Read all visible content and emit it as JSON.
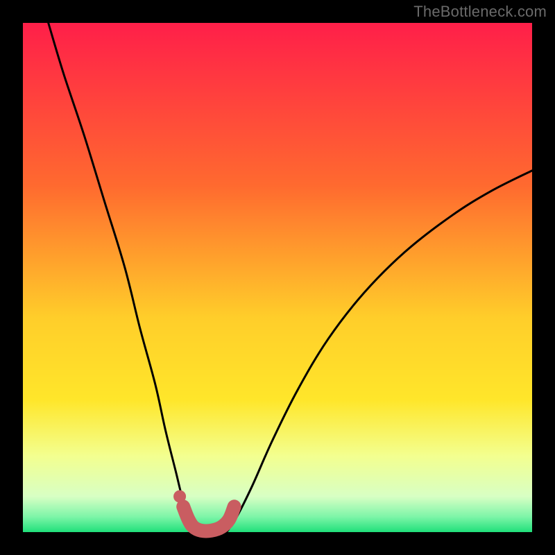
{
  "watermark": "TheBottleneck.com",
  "chart_data": {
    "type": "line",
    "title": "",
    "xlabel": "",
    "ylabel": "",
    "xlim": [
      0,
      100
    ],
    "ylim": [
      0,
      100
    ],
    "grid": false,
    "legend": false,
    "series": [
      {
        "name": "left-branch",
        "x": [
          5,
          8,
          12,
          16,
          20,
          23,
          26,
          28,
          30,
          31.5,
          33,
          34
        ],
        "y": [
          100,
          90,
          78,
          65,
          52,
          40,
          29,
          20,
          12,
          6,
          2,
          0
        ]
      },
      {
        "name": "right-branch",
        "x": [
          40,
          42,
          45,
          49,
          54,
          60,
          67,
          75,
          84,
          92,
          100
        ],
        "y": [
          0,
          3,
          9,
          18,
          28,
          38,
          47,
          55,
          62,
          67,
          71
        ]
      }
    ],
    "highlight_segment": {
      "name": "bottom-u",
      "x": [
        31.5,
        32.5,
        33.5,
        35,
        37,
        39,
        40.5,
        41.5
      ],
      "y": [
        5,
        2.5,
        1,
        0.3,
        0.3,
        1,
        2.5,
        5
      ]
    },
    "highlight_dot": {
      "x": 30.8,
      "y": 7
    },
    "colors": {
      "curve": "#000000",
      "highlight": "#c95d61",
      "gradient_top": "#ff1f49",
      "gradient_mid_orange": "#ff8e2b",
      "gradient_yellow": "#ffe62a",
      "gradient_pale": "#f6ffb0",
      "gradient_green": "#20e07a",
      "frame": "#000000"
    }
  }
}
